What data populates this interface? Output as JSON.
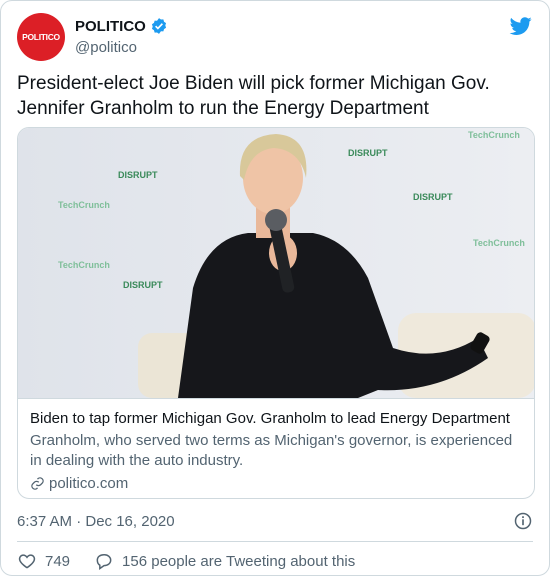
{
  "account": {
    "avatar_text": "POLITICO",
    "name": "POLITICO",
    "handle": "@politico",
    "verified_icon": "verified-badge-icon",
    "brand_icon": "twitter-bird-icon"
  },
  "tweet": {
    "text_line1": "President-elect Joe Biden will pick former Michigan Gov.",
    "text_line2": "Jennifer Granholm to run the Energy Department"
  },
  "card": {
    "title": "Biden to tap former Michigan Gov. Granholm to lead Energy Department",
    "description": "Granholm, who served two terms as Michigan's governor, is experienced in dealing with the auto industry.",
    "domain": "politico.com",
    "backdrop_texts": [
      "DISRUPT",
      "TechCrunch",
      "DISRUPT",
      "TechCrunch",
      "DISRUPT",
      "TechCrunch",
      "DISRUPT",
      "TechCrunch"
    ]
  },
  "meta": {
    "timestamp": "6:37 AM · Dec 16, 2020"
  },
  "actions": {
    "likes": "749",
    "conversation": "156 people are Tweeting about this"
  },
  "colors": {
    "brand_red": "#dc1f26",
    "twitter_blue": "#1d9bf0",
    "muted": "#536471"
  }
}
